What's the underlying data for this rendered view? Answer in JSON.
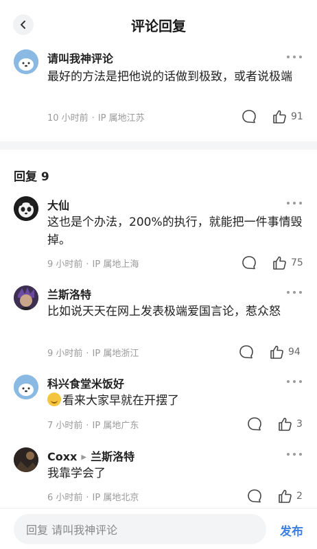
{
  "header": {
    "title": "评论回复"
  },
  "main_comment": {
    "name": "请叫我神评论",
    "text": "最好的方法是把他说的话做到极致，或者说极端",
    "time": "10 小时前",
    "ip": "IP 属地江苏",
    "likes": "91"
  },
  "replies_section": {
    "title": "回复 9"
  },
  "replies": [
    {
      "name": "大仙",
      "text": "这也是个办法，200%的执行，就能把一件事情毁掉。",
      "time": "9 小时前",
      "ip": "IP 属地上海",
      "likes": "75"
    },
    {
      "name": "兰斯洛特",
      "text": "比如说天天在网上发表极端爱国言论，惹众怒",
      "time": "9 小时前",
      "ip": "IP 属地浙江",
      "likes": "94"
    },
    {
      "name": "科兴食堂米饭好",
      "text": "看来大家早就在开摆了",
      "time": "7 小时前",
      "ip": "IP 属地广东",
      "likes": "3",
      "emoji": "sweat-smile-emoji"
    },
    {
      "name": "Coxx",
      "reply_to": "兰斯洛特",
      "text": "我靠学会了",
      "time": "6 小时前",
      "ip": "IP 属地北京",
      "likes": "2"
    }
  ],
  "bottom_bar": {
    "placeholder": "回复 请叫我神评论",
    "publish_label": "发布"
  },
  "colors": {
    "accent": "#3b7fe3",
    "meta": "#999999",
    "divider": "#f4f5f7"
  }
}
